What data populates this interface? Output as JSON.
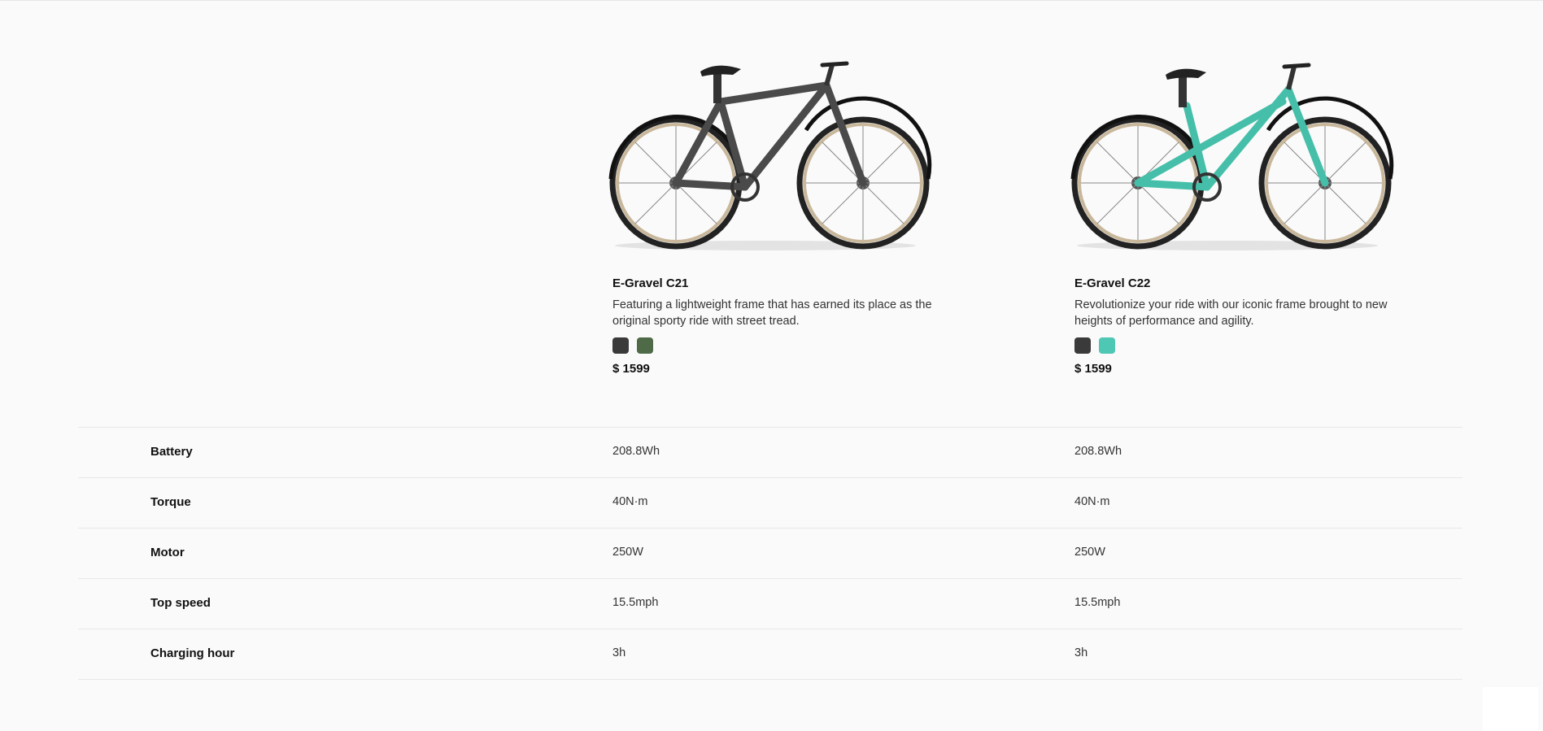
{
  "products": [
    {
      "name": "E-Gravel C21",
      "description": "Featuring a lightweight frame that has earned its place as the original sporty ride with street tread.",
      "swatches": [
        "#3a3a3a",
        "#4e6a47"
      ],
      "price": "$ 1599",
      "frame_color": "#4a4a4a"
    },
    {
      "name": "E-Gravel C22",
      "description": "Revolutionize your ride with our iconic frame brought to new heights of performance and agility.",
      "swatches": [
        "#3a3a3a",
        "#4ec7b4"
      ],
      "price": "$ 1599",
      "frame_color": "#45bfa9"
    }
  ],
  "specs": [
    {
      "label": "Battery",
      "c21": "208.8Wh",
      "c22": "208.8Wh"
    },
    {
      "label": "Torque",
      "c21": "40N·m",
      "c22": "40N·m"
    },
    {
      "label": "Motor",
      "c21": "250W",
      "c22": "250W"
    },
    {
      "label": "Top speed",
      "c21": "15.5mph",
      "c22": "15.5mph"
    },
    {
      "label": "Charging hour",
      "c21": "3h",
      "c22": "3h"
    }
  ]
}
